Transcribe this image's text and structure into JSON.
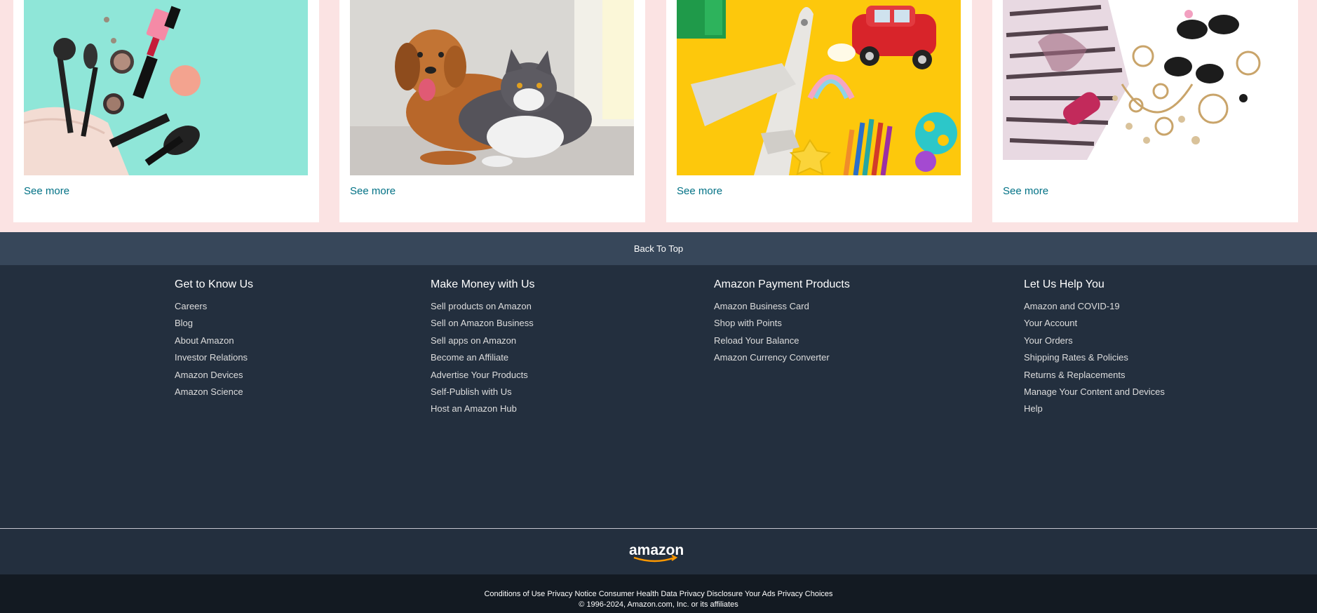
{
  "cards": [
    {
      "link": "See more",
      "image": "cosmetics-image"
    },
    {
      "link": "See more",
      "image": "pets-image"
    },
    {
      "link": "See more",
      "image": "toys-image"
    },
    {
      "link": "See more",
      "image": "fashion-accessories-image"
    }
  ],
  "back_to_top": "Back To Top",
  "footer": {
    "columns": [
      {
        "title": "Get to Know Us",
        "links": [
          "Careers",
          "Blog",
          "About Amazon",
          "Investor Relations",
          "Amazon Devices",
          "Amazon Science"
        ]
      },
      {
        "title": "Make Money with Us",
        "links": [
          "Sell products on Amazon",
          "Sell on Amazon Business",
          "Sell apps on Amazon",
          "Become an Affiliate",
          "Advertise Your Products",
          "Self-Publish with Us",
          "Host an Amazon Hub"
        ]
      },
      {
        "title": "Amazon Payment Products",
        "links": [
          "Amazon Business Card",
          "Shop with Points",
          "Reload Your Balance",
          "Amazon Currency Converter"
        ]
      },
      {
        "title": "Let Us Help You",
        "links": [
          "Amazon and COVID-19",
          "Your Account",
          "Your Orders",
          "Shipping Rates & Policies",
          "Returns & Replacements",
          "Manage Your Content and Devices",
          "Help"
        ]
      }
    ],
    "logo_text": "amazon",
    "legal_links": [
      "Conditions of Use",
      "Privacy Notice",
      "Consumer Health Data Privacy Disclosure",
      "Your Ads Privacy Choices"
    ],
    "copyright": "© 1996-2024, Amazon.com, Inc. or its affiliates"
  },
  "colors": {
    "link": "#007185",
    "back_to_top_bg": "#37475a",
    "footer_bg": "#232f3e",
    "legal_bg": "#131a22",
    "page_bg": "#fbe3e3",
    "logo_smile": "#ff9900"
  }
}
